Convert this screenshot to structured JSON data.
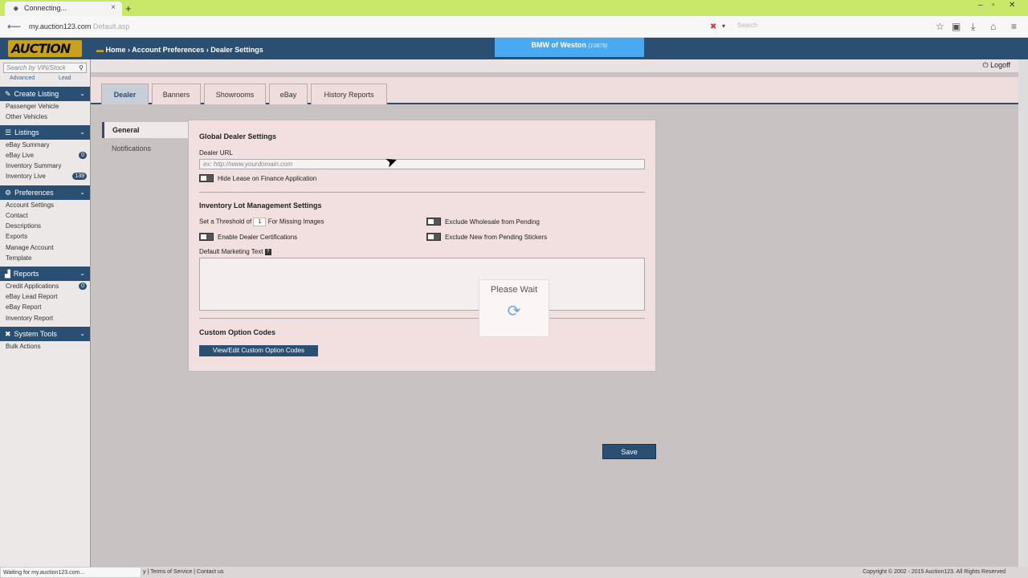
{
  "browser": {
    "tab_title": "Connecting...",
    "tab_spinner": "✸",
    "url_host": "my.auction123.com",
    "url_path": "Default.asp",
    "search_placeholder": "Search",
    "new_tab": "+",
    "close_tab": "×"
  },
  "header": {
    "logo_text": "AUCTION",
    "breadcrumb": "Home › Account Preferences › Dealer Settings",
    "dealer_name": "BMW of Weston",
    "dealer_id": "(10879)",
    "logoff": "Logoff"
  },
  "sidebar": {
    "search_placeholder": "Search by VIN/Stock",
    "advanced": "Advanced",
    "lead": "Lead",
    "sections": [
      {
        "label": "Create Listing",
        "items": [
          {
            "label": "Passenger Vehicle"
          },
          {
            "label": "Other Vehicles"
          }
        ]
      },
      {
        "label": "Listings",
        "items": [
          {
            "label": "eBay Summary"
          },
          {
            "label": "eBay Live",
            "badge": "0"
          },
          {
            "label": "Inventory Summary"
          },
          {
            "label": "Inventory Live",
            "badge": "139"
          }
        ]
      },
      {
        "label": "Preferences",
        "items": [
          {
            "label": "Account Settings"
          },
          {
            "label": "Contact"
          },
          {
            "label": "Descriptions"
          },
          {
            "label": "Exports"
          },
          {
            "label": "Manage Account"
          },
          {
            "label": "Template"
          }
        ]
      },
      {
        "label": "Reports",
        "items": [
          {
            "label": "Credit Applications",
            "badge": "0"
          },
          {
            "label": "eBay Lead Report"
          },
          {
            "label": "eBay Report"
          },
          {
            "label": "Inventory Report"
          }
        ]
      },
      {
        "label": "System Tools",
        "items": [
          {
            "label": "Bulk Actions"
          }
        ]
      }
    ]
  },
  "tabs": [
    "Dealer",
    "Banners",
    "Showrooms",
    "eBay",
    "History Reports"
  ],
  "left_nav": {
    "general": "General",
    "notifications": "Notifications"
  },
  "panel": {
    "global_heading": "Global Dealer Settings",
    "dealer_url_label": "Dealer URL",
    "dealer_url_placeholder": "ex: http://www.yourdomain.com",
    "hide_lease_label": "Hide Lease on Finance Application",
    "inventory_heading": "Inventory Lot Management Settings",
    "threshold_prefix": "Set a Threshold of",
    "threshold_value": "1",
    "threshold_suffix": "For Missing Images",
    "exclude_wholesale": "Exclude Wholesale from Pending",
    "enable_certifications": "Enable Dealer Certifications",
    "exclude_new": "Exclude New from Pending Stickers",
    "marketing_label": "Default Marketing Text",
    "custom_heading": "Custom Option Codes",
    "custom_button": "View/Edit Custom Option Codes"
  },
  "please_wait": "Please Wait",
  "save_button": "Save",
  "status": {
    "text": "Waiting for my.auction123.com...",
    "footer_links": "y | Terms of Service | Contact us",
    "copyright": "Copyright © 2002 - 2015 Auction123. All Rights Reserved"
  }
}
